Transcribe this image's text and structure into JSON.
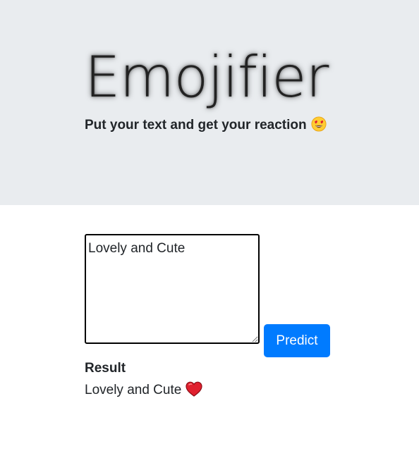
{
  "header": {
    "title": "Emojifier",
    "subtitle": "Put your text and get your reaction",
    "subtitle_icon": "heart-eyes-emoji"
  },
  "form": {
    "input_value": "Lovely and Cute",
    "predict_label": "Predict"
  },
  "result": {
    "label": "Result",
    "text": "Lovely and Cute",
    "emoji_icon": "red-heart-emoji"
  },
  "colors": {
    "header_bg": "#e9ecef",
    "button_bg": "#007bff",
    "heart_red": "#e0202e"
  }
}
